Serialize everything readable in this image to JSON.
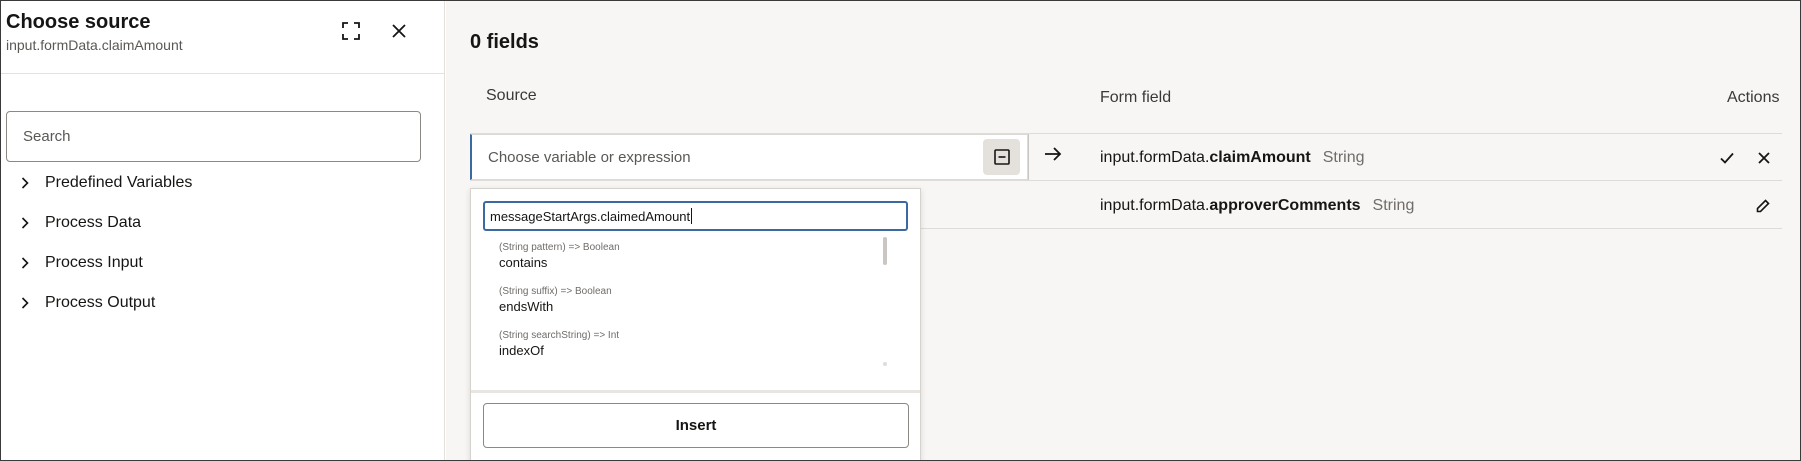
{
  "left_panel": {
    "title": "Choose source",
    "subtitle": "input.formData.claimAmount",
    "expand_icon": "expand-icon",
    "close_icon": "close-icon",
    "search_placeholder": "Search",
    "tree": [
      {
        "label": "Predefined Variables"
      },
      {
        "label": "Process Data"
      },
      {
        "label": "Process Input"
      },
      {
        "label": "Process Output"
      }
    ]
  },
  "main": {
    "fields_title": "0 fields",
    "columns": {
      "source": "Source",
      "form_field": "Form field",
      "actions": "Actions"
    },
    "rows": [
      {
        "source_placeholder": "Choose variable or expression",
        "field_prefix": "input.formData.",
        "field_name": "claimAmount",
        "field_type": "String"
      },
      {
        "field_prefix": "input.formData.",
        "field_name": "approverComments",
        "field_type": "String"
      }
    ]
  },
  "popup": {
    "expression_value": "messageStartArgs.claimedAmount",
    "suggestions": [
      {
        "signature": "(String pattern) => Boolean",
        "name": "contains"
      },
      {
        "signature": "(String suffix) => Boolean",
        "name": "endsWith"
      },
      {
        "signature": "(String searchString) => Int",
        "name": "indexOf"
      }
    ],
    "insert_label": "Insert"
  },
  "colors": {
    "accent": "#3b6aa0",
    "panel_bg": "#f8f6f4"
  }
}
